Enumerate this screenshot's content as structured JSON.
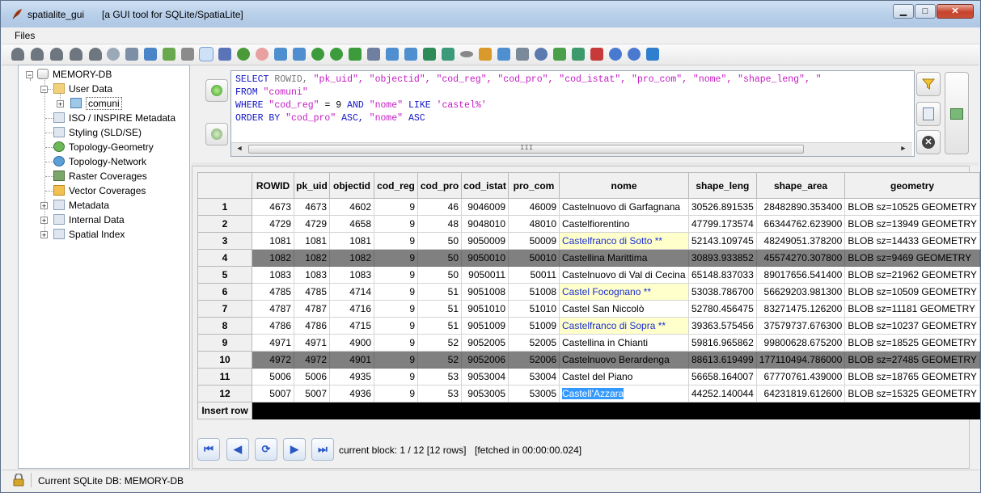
{
  "window": {
    "app_name": "spatialite_gui",
    "description": "[a GUI tool for SQLite/SpatiaLite]",
    "min_label": "▁",
    "max_label": "□",
    "close_label": "✕"
  },
  "menu": {
    "files": "Files"
  },
  "tree": {
    "root": "MEMORY-DB",
    "items": [
      {
        "label": "User Data"
      },
      {
        "label": "comuni"
      },
      {
        "label": "ISO / INSPIRE Metadata"
      },
      {
        "label": "Styling (SLD/SE)"
      },
      {
        "label": "Topology-Geometry"
      },
      {
        "label": "Topology-Network"
      },
      {
        "label": "Raster Coverages"
      },
      {
        "label": "Vector Coverages"
      },
      {
        "label": "Metadata"
      },
      {
        "label": "Internal Data"
      },
      {
        "label": "Spatial Index"
      }
    ]
  },
  "sql": {
    "l1_select": "SELECT",
    "l1_rowid": "ROWID,",
    "l1_cols": "\"pk_uid\", \"objectid\", \"cod_reg\", \"cod_pro\", \"cod_istat\", \"pro_com\", \"nome\", \"shape_leng\", \"",
    "l2_from": "FROM",
    "l2_table": "\"comuni\"",
    "l3_where": "WHERE",
    "l3_a": "\"cod_reg\"",
    "l3_eq": "= 9",
    "l3_and": "AND",
    "l3_b": "\"nome\"",
    "l3_like": "LIKE",
    "l3_pat": "'castel%'",
    "l4_order": "ORDER BY",
    "l4_a": "\"cod_pro\"",
    "l4_asc1": "ASC,",
    "l4_b": "\"nome\"",
    "l4_asc2": "ASC",
    "scroll_mark": "III"
  },
  "grid": {
    "columns": [
      "ROWID",
      "pk_uid",
      "objectid",
      "cod_reg",
      "cod_pro",
      "cod_istat",
      "pro_com",
      "nome",
      "shape_leng",
      "shape_area",
      "geometry"
    ],
    "rows": [
      {
        "n": "1",
        "c": [
          "4673",
          "4673",
          "4602",
          "9",
          "46",
          "9046009",
          "46009",
          "Castelnuovo di Garfagnana",
          "30526.891535",
          "28482890.353400",
          "BLOB sz=10525 GEOMETRY"
        ]
      },
      {
        "n": "2",
        "c": [
          "4729",
          "4729",
          "4658",
          "9",
          "48",
          "9048010",
          "48010",
          "Castelfiorentino",
          "47799.173574",
          "66344762.623900",
          "BLOB sz=13949 GEOMETRY"
        ]
      },
      {
        "n": "3",
        "c": [
          "1081",
          "1081",
          "1081",
          "9",
          "50",
          "9050009",
          "50009",
          "Castelfranco di Sotto **",
          "52143.109745",
          "48249051.378200",
          "BLOB sz=14433 GEOMETRY"
        ]
      },
      {
        "n": "4",
        "c": [
          "1082",
          "1082",
          "1082",
          "9",
          "50",
          "9050010",
          "50010",
          "Castellina Marittima",
          "30893.933852",
          "45574270.307800",
          "BLOB sz=9469 GEOMETRY"
        ]
      },
      {
        "n": "5",
        "c": [
          "1083",
          "1083",
          "1083",
          "9",
          "50",
          "9050011",
          "50011",
          "Castelnuovo di Val di Cecina",
          "65148.837033",
          "89017656.541400",
          "BLOB sz=21962 GEOMETRY"
        ]
      },
      {
        "n": "6",
        "c": [
          "4785",
          "4785",
          "4714",
          "9",
          "51",
          "9051008",
          "51008",
          "Castel Focognano **",
          "53038.786700",
          "56629203.981300",
          "BLOB sz=10509 GEOMETRY"
        ]
      },
      {
        "n": "7",
        "c": [
          "4787",
          "4787",
          "4716",
          "9",
          "51",
          "9051010",
          "51010",
          "Castel San Niccolò",
          "52780.456475",
          "83271475.126200",
          "BLOB sz=11181 GEOMETRY"
        ]
      },
      {
        "n": "8",
        "c": [
          "4786",
          "4786",
          "4715",
          "9",
          "51",
          "9051009",
          "51009",
          "Castelfranco di Sopra **",
          "39363.575456",
          "37579737.676300",
          "BLOB sz=10237 GEOMETRY"
        ]
      },
      {
        "n": "9",
        "c": [
          "4971",
          "4971",
          "4900",
          "9",
          "52",
          "9052005",
          "52005",
          "Castellina in Chianti",
          "59816.965862",
          "99800628.675200",
          "BLOB sz=18525 GEOMETRY"
        ]
      },
      {
        "n": "10",
        "c": [
          "4972",
          "4972",
          "4901",
          "9",
          "52",
          "9052006",
          "52006",
          "Castelnuovo Berardenga",
          "88613.619499",
          "177110494.786000",
          "BLOB sz=27485 GEOMETRY"
        ]
      },
      {
        "n": "11",
        "c": [
          "5006",
          "5006",
          "4935",
          "9",
          "53",
          "9053004",
          "53004",
          "Castel del Piano",
          "56658.164007",
          "67770761.439000",
          "BLOB sz=18765 GEOMETRY"
        ]
      },
      {
        "n": "12",
        "c": [
          "5007",
          "5007",
          "4936",
          "9",
          "53",
          "9053005",
          "53005",
          "Castell'Azzara",
          "44252.140044",
          "64231819.612600",
          "BLOB sz=15325 GEOMETRY"
        ]
      }
    ],
    "insert_label": "Insert row"
  },
  "nav": {
    "block_info": "current block: 1 / 12 [12 rows]",
    "fetch_info": "[fetched in 00:00:00.024]"
  },
  "status": {
    "text": "Current SQLite DB: MEMORY-DB"
  },
  "colors": {
    "title_bar": "#b9d0ea",
    "keyword": "#1316c4",
    "string": "#c41bc4",
    "selected_row": "#808080",
    "highlight_cell": "#ffffcc"
  }
}
